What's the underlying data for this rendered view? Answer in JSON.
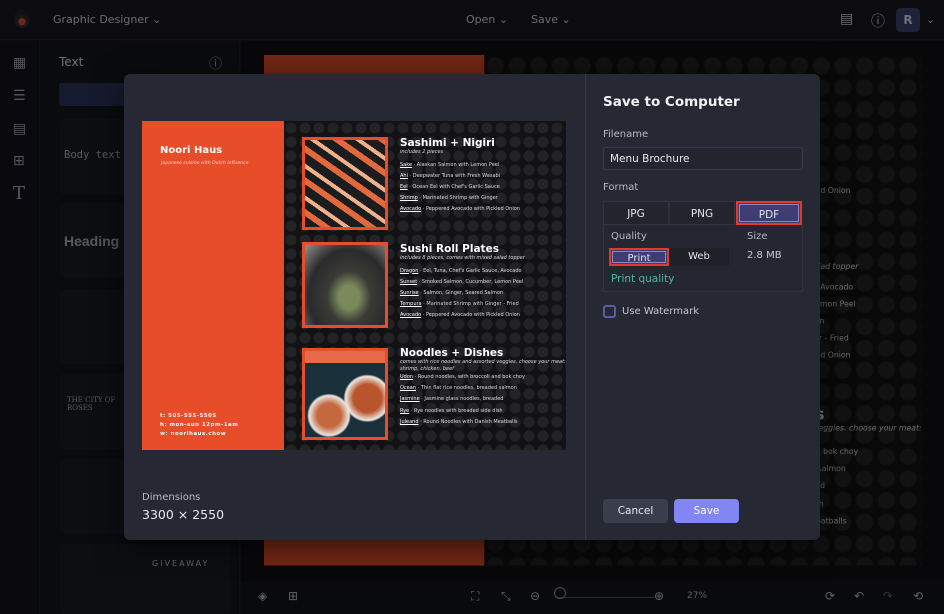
{
  "topbar": {
    "project": "Graphic Designer",
    "open": "Open",
    "save": "Save",
    "avatar": "R"
  },
  "sidebar": {
    "title": "Text",
    "cards": [
      "Body text",
      "Heading",
      "THE CITY OF ROSES",
      "GIVEAWAY"
    ]
  },
  "zoom": "27%",
  "brochure": {
    "name": "Noori Haus",
    "tagline": "Japanese cuisine with Dutch influence",
    "contact": [
      "t: 505-555-5505",
      "h: mon-sun 12pm-1am",
      "w: noorihaus.chow"
    ],
    "sections": [
      {
        "title": "Sashimi + Nigiri",
        "subtitle": "includes 2 pieces",
        "items": [
          {
            "name": "Sake",
            "desc": " · Alaskan Salmon with Lemon Peel"
          },
          {
            "name": "Ahi",
            "desc": " · Deepwater Tuna with Fresh Wasabi"
          },
          {
            "name": "Eel",
            "desc": " · Ocean Eel with Chef's Garlic Sauce"
          },
          {
            "name": "Shrimp",
            "desc": " · Marinated Shrimp with Ginger"
          },
          {
            "name": "Avocado",
            "desc": " · Peppered Avocado with Pickled Onion"
          }
        ]
      },
      {
        "title": "Sushi Roll Plates",
        "subtitle": "includes 8 pieces, comes with mixed salad topper",
        "items": [
          {
            "name": "Dragon",
            "desc": " · Eel, Tuna, Chef's Garlic Sauce, Avocado"
          },
          {
            "name": "Sunset",
            "desc": " · Smoked Salmon, Cucumber, Lemon Peel"
          },
          {
            "name": "Sunrise",
            "desc": " · Salmon, Ginger, Seared Salmon"
          },
          {
            "name": "Tempura",
            "desc": " · Marinated Shrimp with Ginger - Fried"
          },
          {
            "name": "Avocado",
            "desc": " · Peppered Avocado with Pickled Onion"
          }
        ]
      },
      {
        "title": "Noodles + Dishes",
        "subtitle": "comes with rice noodles and assorted veggies. choose your meat: shrimp, chicken, beef",
        "items": [
          {
            "name": "Udon",
            "desc": " · Round noodles, with broccoli and bok choy"
          },
          {
            "name": "Ocean",
            "desc": " · Thin flat rice noodles, breaded salmon"
          },
          {
            "name": "Jasmine",
            "desc": " · Jasmine glass noodles, breaded"
          },
          {
            "name": "Rye",
            "desc": " · Rye noodles with breaded side dish"
          },
          {
            "name": "Juleand",
            "desc": " · Round Noodles with Danish Meatballs"
          }
        ]
      }
    ]
  },
  "modal": {
    "title": "Save to Computer",
    "filename_label": "Filename",
    "filename": "Menu Brochure",
    "format_label": "Format",
    "formats": [
      "JPG",
      "PNG",
      "PDF"
    ],
    "selected_format": "PDF",
    "quality_label": "Quality",
    "qualities": [
      "Print",
      "Web"
    ],
    "selected_quality": "Print",
    "quality_note": "Print quality",
    "size_label": "Size",
    "size": "2.8 MB",
    "watermark_label": "Use Watermark",
    "watermark_checked": false,
    "dimensions_label": "Dimensions",
    "dimensions": "3300 × 2550",
    "cancel": "Cancel",
    "save": "Save"
  },
  "colors": {
    "accent": "#8186f4",
    "brand_orange": "#e84d2a",
    "highlight": "#e3392a",
    "success": "#4fb79a"
  }
}
